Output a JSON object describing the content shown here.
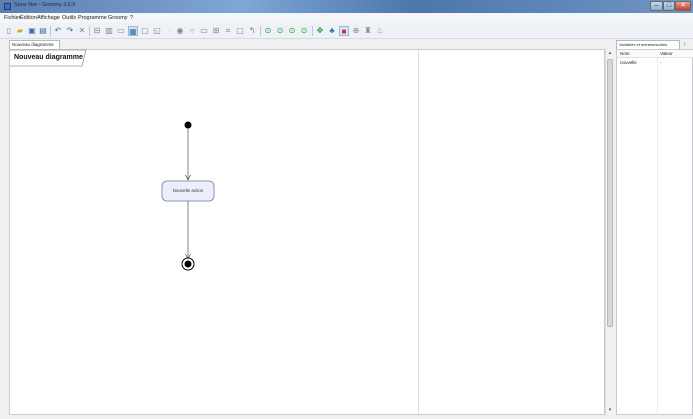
{
  "window": {
    "title": "Sans titre - Groomy 3.6.5"
  },
  "menu": [
    "Fichier",
    "Édition",
    "Affichage",
    "Outils",
    "Programme",
    "Groomy",
    "?"
  ],
  "toolbar": {
    "icons": [
      "new-file-icon",
      "open-folder-icon",
      "save-icon",
      "save-as-icon",
      "undo-icon",
      "redo-icon",
      "delete-icon",
      "print-icon",
      "export-icon",
      "view-icon",
      "layout-icon",
      "layout-selected-icon",
      "page-icon",
      "dot-icon",
      "initial-node-icon",
      "decision-icon",
      "fork-icon",
      "join-icon",
      "action-icon",
      "transition-icon",
      "run-icon",
      "step-icon",
      "step-over-icon",
      "stop-icon",
      "move-icon",
      "variables-icon",
      "breakpoint-icon",
      "watch-icon",
      "find-icon",
      "help-icon"
    ]
  },
  "tabs": {
    "diagram": "Nouveau diagramme"
  },
  "diagram": {
    "title": "Nouveau diagramme",
    "action_label": "Nouvelle action"
  },
  "panel": {
    "tab": "Variables et entrées/sorties",
    "columns": [
      "Nom",
      "Valeur"
    ],
    "rows": [
      {
        "name": "nouvelle",
        "value": "-"
      }
    ]
  }
}
